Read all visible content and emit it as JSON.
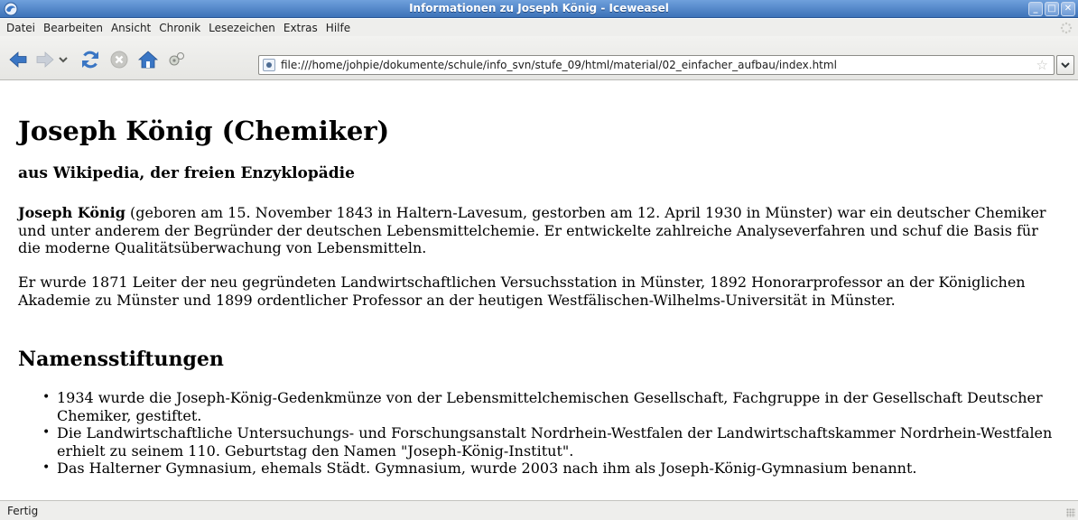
{
  "window": {
    "title": "Informationen zu Joseph König - Iceweasel",
    "controls": [
      "_",
      "□",
      "✕"
    ]
  },
  "menubar": {
    "items": [
      {
        "label": "Datei"
      },
      {
        "label": "Bearbeiten"
      },
      {
        "label": "Ansicht"
      },
      {
        "label": "Chronik"
      },
      {
        "label": "Lesezeichen"
      },
      {
        "label": "Extras"
      },
      {
        "label": "Hilfe"
      }
    ]
  },
  "toolbar": {
    "icons": [
      "back-arrow-icon",
      "forward-arrow-icon",
      "history-dropdown-icon",
      "reload-icon",
      "stop-icon",
      "home-icon",
      "plugin-icon"
    ],
    "url": "file:///home/johpie/dokumente/schule/info_svn/stufe_09/html/material/02_einfacher_aufbau/index.html",
    "star_glyph": "☆",
    "dropdown_glyph": "⌄"
  },
  "page": {
    "title": "Joseph König (Chemiker)",
    "subtitle": "aus Wikipedia, der freien Enzyklopädie",
    "p1_name": "Joseph König",
    "p1_text": " (geboren am 15. November 1843 in Haltern-Lavesum, gestorben am 12. April 1930 in Münster) war ein deutscher Chemiker und unter anderem der Begründer der deutschen Lebensmittelchemie. Er entwickelte zahlreiche Analyseverfahren und schuf die Basis für die moderne Qualitätsüberwachung von Lebensmitteln.",
    "p2_text": "Er wurde 1871 Leiter der neu gegründeten Landwirtschaftlichen Versuchsstation in Münster, 1892 Honorarprofessor an der Königlichen Akademie zu Münster und 1899 ordentlicher Professor an der heutigen Westfälischen-Wilhelms-Universität in Münster.",
    "section_title": "Namensstiftungen",
    "bullet": "•",
    "list": [
      "1934 wurde die Joseph-König-Gedenkmünze von der Lebensmittelchemischen Gesellschaft, Fachgruppe in der Gesellschaft Deutscher Chemiker, gestiftet.",
      "Die Landwirtschaftliche Untersuchungs- und Forschungsanstalt Nordrhein-Westfalen der Landwirtschaftskammer Nordrhein-Westfalen erhielt zu seinem 110. Geburtstag den Namen \"Joseph-König-Institut\".",
      "Das Halterner Gymnasium, ehemals Städt. Gymnasium, wurde 2003 nach ihm als Joseph-König-Gymnasium benannt."
    ]
  },
  "status": {
    "text": "Fertig"
  },
  "colors": {
    "titlebar": "#3c72b8",
    "nav_icon_blue": "#3a76c4",
    "reload_green": "#4e9a06",
    "stop_gray": "#b8b8b4"
  }
}
